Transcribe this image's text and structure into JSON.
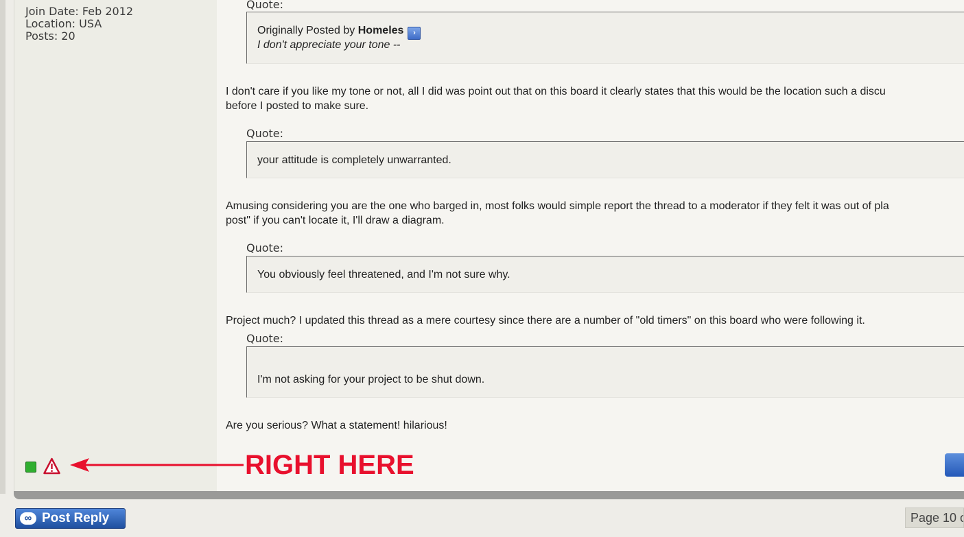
{
  "user": {
    "join_date": "Join Date: Feb 2012",
    "location": "Location: USA",
    "posts": "Posts: 20"
  },
  "quote_label": "Quote:",
  "quotes": [
    {
      "prefix": "Originally Posted by ",
      "author": "Homeles",
      "text": "I don't appreciate your tone --"
    },
    {
      "text": "your attitude is completely unwarranted."
    },
    {
      "text": "You obviously feel threatened, and I'm not sure why."
    },
    {
      "text": "I'm not asking for your project to be shut down."
    }
  ],
  "paragraphs": [
    "I don't care if you like my tone or not, all I did was point out that on this board it clearly states that this would be the location such a discu",
    "before I posted to make sure.",
    "Amusing considering you are the one who barged in, most folks would simple report the thread to a moderator if they felt it was out of pla",
    "post\" if you can't locate it, I'll draw a diagram.",
    "Project much? I updated this thread as a mere courtesy since there are a number of \"old timers\" on this board who were following it.",
    "Are you serious? What a statement! hilarious!"
  ],
  "annotation": "RIGHT HERE",
  "colors": {
    "annotation": "#e8102d",
    "online": "#2fae2f",
    "button": "#1f4f9f"
  },
  "icons": {
    "online": "online-status-icon",
    "report": "report-post-icon",
    "viewpost": "view-post-icon"
  },
  "footer": {
    "post_reply": "Post Reply",
    "page_nav": "Page 10 o"
  }
}
